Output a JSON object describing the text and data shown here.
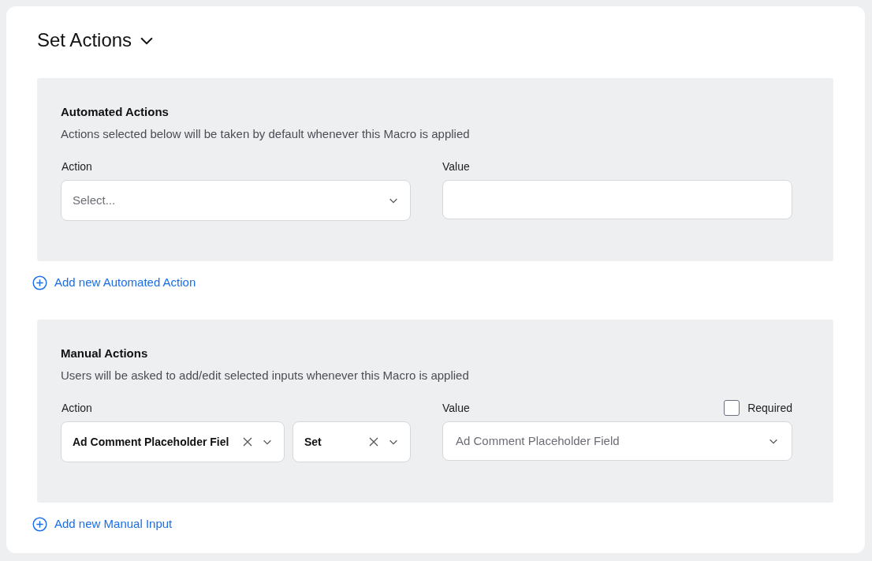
{
  "section": {
    "title": "Set Actions",
    "expanded": true
  },
  "groups": [
    {
      "title": "Automated Actions",
      "description": "Actions selected below will be taken by default whenever this Macro is applied",
      "action_label": "Action",
      "action_fields": [
        {
          "kind": "select",
          "placeholder": "Select..."
        }
      ],
      "value_label": "Value",
      "value_field": {
        "kind": "text"
      },
      "add_link": "Add new Automated Action"
    },
    {
      "title": "Manual Actions",
      "description": "Users will be asked to add/edit selected inputs whenever this Macro is applied",
      "action_label": "Action",
      "action_fields": [
        {
          "kind": "chosen",
          "value": "Ad Comment Placeholder Fiel"
        },
        {
          "kind": "chosen",
          "value": "Set"
        }
      ],
      "value_label": "Value",
      "required": {
        "label": "Required",
        "checked": false
      },
      "value_field": {
        "kind": "select",
        "placeholder": "Ad Comment Placeholder Field"
      },
      "add_link": "Add new Manual Input"
    }
  ]
}
